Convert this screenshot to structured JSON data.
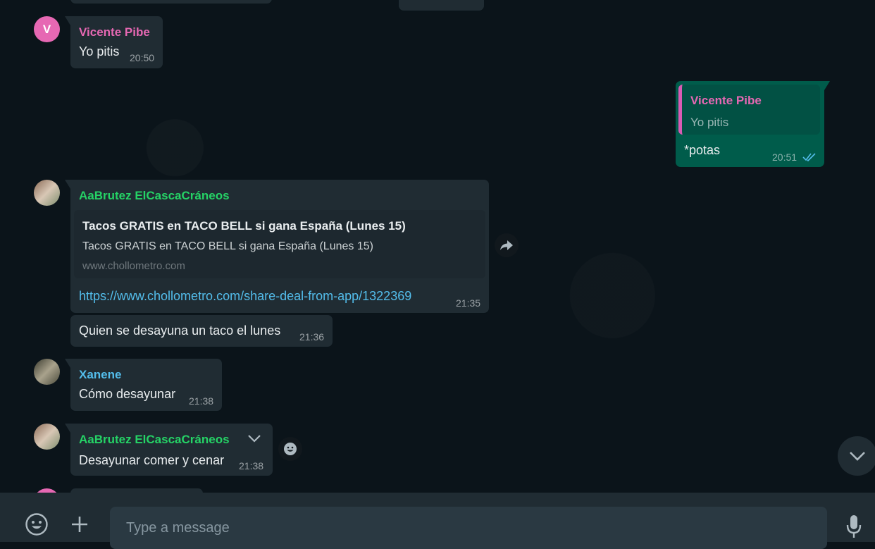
{
  "messages": [
    {
      "sender": "Vicente Pibe",
      "text": "Yo pitis",
      "time": "20:50",
      "avatar_letter": "V"
    },
    {
      "quote_sender": "Vicente Pibe",
      "quote_text": "Yo pitis",
      "text": "*potas",
      "time": "20:51"
    },
    {
      "sender": "AaBrutez ElCascaCráneos",
      "preview_title": "Tacos GRATIS en TACO BELL si gana España (Lunes 15)",
      "preview_desc": "Tacos GRATIS en TACO BELL si gana España (Lunes 15)",
      "preview_domain": "www.chollometro.com",
      "link": "https://www.chollometro.com/share-deal-from-app/1322369",
      "time": "21:35"
    },
    {
      "text": "Quien se desayuna un taco el lunes",
      "time": "21:36"
    },
    {
      "sender": "Xanene",
      "text": "Cómo desayunar",
      "time": "21:38"
    },
    {
      "sender": "AaBrutez ElCascaCráneos",
      "text": "Desayunar comer y cenar",
      "time": "21:38"
    }
  ],
  "composer": {
    "placeholder": "Type a message"
  },
  "icons": {
    "emoji": "emoji-icon",
    "attach": "plus-icon",
    "mic": "microphone-icon",
    "forward": "forward-icon",
    "scroll_down": "chevron-down-icon",
    "react": "emoji-reaction-icon",
    "menu": "chevron-down-icon",
    "read": "double-check-icon"
  },
  "colors": {
    "background": "#0b141a",
    "bubble_in": "#202c33",
    "bubble_out": "#005c4b",
    "name_pink": "#e668b3",
    "name_green": "#25d366",
    "name_blue": "#53bdeb",
    "link": "#53bdeb"
  }
}
